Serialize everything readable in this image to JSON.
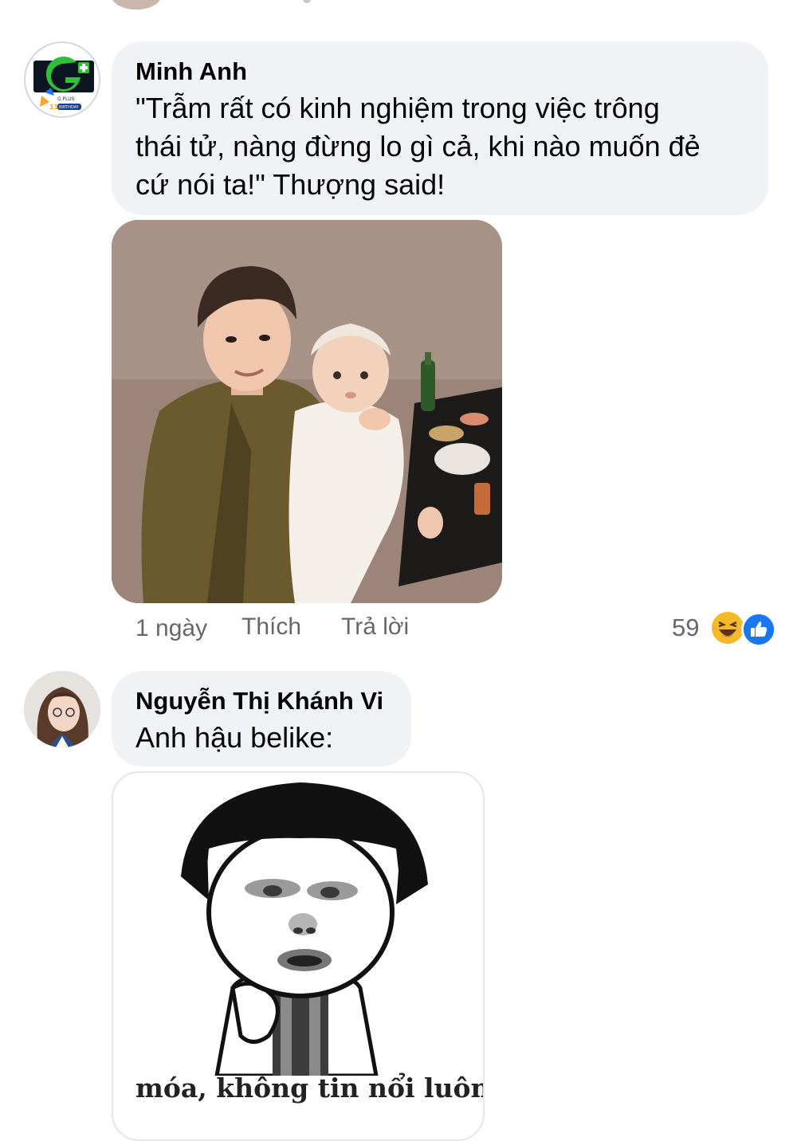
{
  "comments": [
    {
      "author": "Minh Anh",
      "avatar_text": "G PLUS",
      "avatar_badge": "BIRTHDAY",
      "avatar_number": "11",
      "text_lines": [
        "\"Trẫm rất có kinh nghiệm trong việc trông",
        "thái tử, nàng đừng lo gì cả, khi nào muốn đẻ",
        "cứ nói ta!\" Thượng said!"
      ],
      "image": "photo-man-holding-baby",
      "time": "1 ngày",
      "like_label": "Thích",
      "reply_label": "Trả lời",
      "reaction_count": "59",
      "reactions": [
        "haha-icon",
        "like-icon"
      ]
    },
    {
      "author": "Nguyễn Thị Khánh Vi",
      "text_lines": [
        "Anh hậu belike:"
      ],
      "image": "meme-bowl-cut-face",
      "meme_caption": "móa, không tin nổi luôn á"
    }
  ],
  "colors": {
    "bubble": "#f0f2f5",
    "secondary_text": "#65676b",
    "like_blue": "#1877f2",
    "haha_yellow": "#f7b928"
  }
}
